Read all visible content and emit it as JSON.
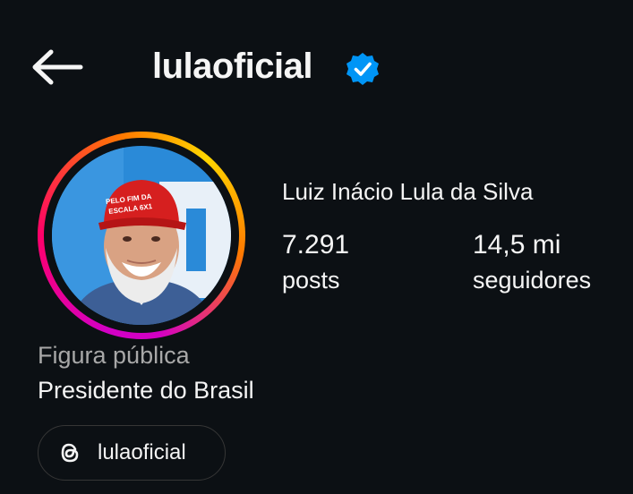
{
  "header": {
    "back_icon": "arrow-left-icon",
    "username": "lulaoficial",
    "verified_icon": "verified-badge-icon",
    "verified_color": "#0095f6"
  },
  "profile": {
    "full_name": "Luiz Inácio Lula da Silva",
    "avatar_cap_text_line1": "PELO FIM DA",
    "avatar_cap_text_line2": "ESCALA 6X1",
    "stats": [
      {
        "value": "7.291",
        "label": "posts"
      },
      {
        "value": "14,5 mi",
        "label": "seguidores"
      }
    ],
    "category": "Figura pública",
    "bio": "Presidente do Brasil",
    "threads": {
      "icon": "threads-icon",
      "label": "lulaoficial"
    }
  },
  "colors": {
    "background": "#0c1014",
    "text": "#f5f5f5",
    "muted_text": "#a8a8a8",
    "story_ring_start": "#d300c5",
    "story_ring_end": "#ffd600"
  }
}
